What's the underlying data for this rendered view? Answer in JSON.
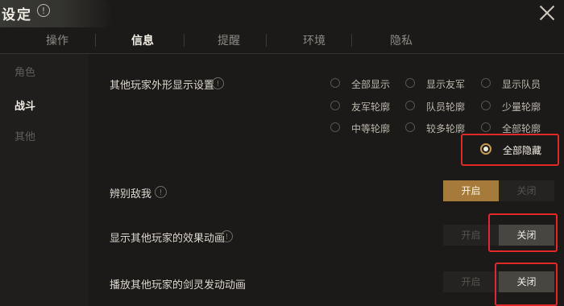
{
  "header": {
    "title": "设定",
    "info_icon": "!"
  },
  "tabs": [
    {
      "label": "操作",
      "active": false
    },
    {
      "label": "信息",
      "active": true
    },
    {
      "label": "提醒",
      "active": false
    },
    {
      "label": "环境",
      "active": false
    },
    {
      "label": "隐私",
      "active": false
    }
  ],
  "sidebar": {
    "items": [
      {
        "label": "角色",
        "active": false
      },
      {
        "label": "战斗",
        "active": true
      },
      {
        "label": "其他",
        "active": false
      }
    ]
  },
  "settings": {
    "appearance": {
      "label": "其他玩家外形显示设置",
      "options": [
        "全部显示",
        "显示友军",
        "显示队员",
        "友军轮廓",
        "队员轮廓",
        "少量轮廓",
        "中等轮廓",
        "较多轮廓",
        "全部轮廓",
        "全部隐藏"
      ],
      "selected": "全部隐藏"
    },
    "distinguish": {
      "label": "辨别敌我",
      "on": "开启",
      "off": "关闭",
      "value": "开启"
    },
    "effects": {
      "label": "显示其他玩家的效果动画",
      "on": "开启",
      "off": "关闭",
      "value": "关闭"
    },
    "sword_spirit": {
      "label": "播放其他玩家的剑灵发动动画",
      "on": "开启",
      "off": "关闭",
      "value": "关闭"
    }
  },
  "colors": {
    "accent": "#a57a3a",
    "highlight": "#e02a2a",
    "background": "#1b1a19"
  }
}
